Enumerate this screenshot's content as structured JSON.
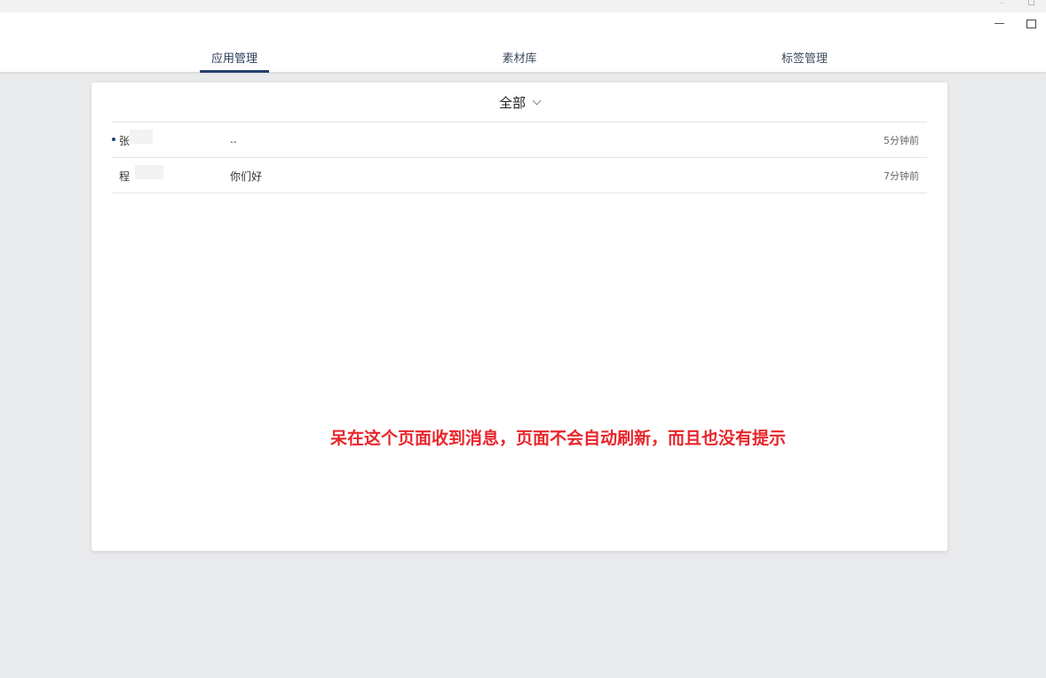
{
  "titlebar": {
    "minimize_icon": "minimize-icon",
    "maximize_icon": "maximize-icon"
  },
  "nav": {
    "tabs": [
      {
        "label": "应用管理",
        "active": true
      },
      {
        "label": "素材库",
        "active": false
      },
      {
        "label": "标签管理",
        "active": false
      }
    ]
  },
  "filter": {
    "label": "全部",
    "icon": "chevron-down-icon"
  },
  "messages": [
    {
      "sender": "张",
      "content": "..",
      "time": "5分钟前",
      "unread": true
    },
    {
      "sender": "程",
      "content": "你们好",
      "time": "7分钟前",
      "unread": false
    }
  ],
  "annotation": {
    "text": "呆在这个页面收到消息，页面不会自动刷新，而且也没有提示",
    "color": "#e8262c"
  },
  "colors": {
    "accent": "#23406e",
    "background": "#e9eaec"
  }
}
